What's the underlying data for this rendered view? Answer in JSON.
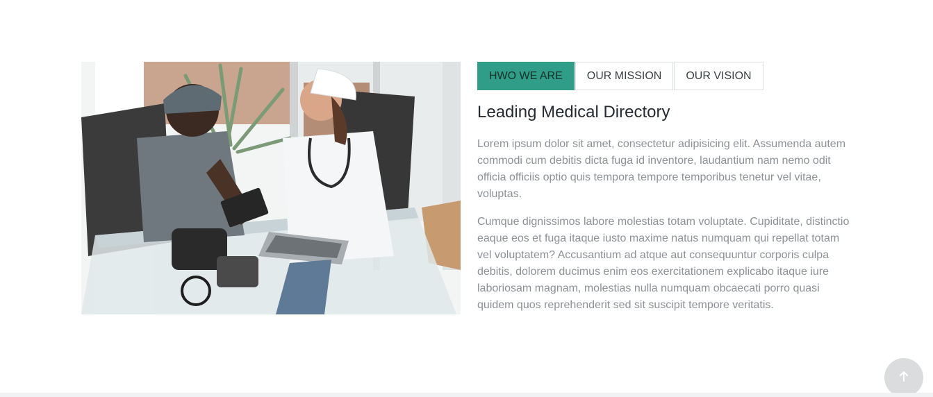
{
  "tabs": [
    {
      "label": "HWO WE ARE",
      "active": true
    },
    {
      "label": "OUR MISSION",
      "active": false
    },
    {
      "label": "OUR VISION",
      "active": false
    }
  ],
  "section": {
    "heading": "Leading Medical Directory",
    "paragraphs": [
      "Lorem ipsum dolor sit amet, consectetur adipisicing elit. Assumenda autem commodi cum debitis dicta fuga id inventore, laudantium nam nemo odit officia officiis optio quis tempora tempore temporibus tenetur vel vitae, voluptas.",
      "Cumque dignissimos labore molestias totam voluptate. Cupiditate, distinctio eaque eos et fuga itaque iusto maxime natus numquam qui repellat totam vel voluptatem? Accusantium ad atque aut consequuntur corporis culpa debitis, dolorem ducimus enim eos exercitationem explicabo itaque iure laboriosam magnam, molestias nulla numquam obcaecati porro quasi quidem quos reprehenderit sed sit suscipit tempore veritatis."
    ]
  },
  "colors": {
    "accent": "#2f9d87",
    "heading": "#252a30",
    "body_text": "#8c9196",
    "tab_border": "#dde0e3",
    "back_to_top_bg": "#dadcde"
  },
  "icons": {
    "back_to_top": "arrow-up-icon"
  }
}
